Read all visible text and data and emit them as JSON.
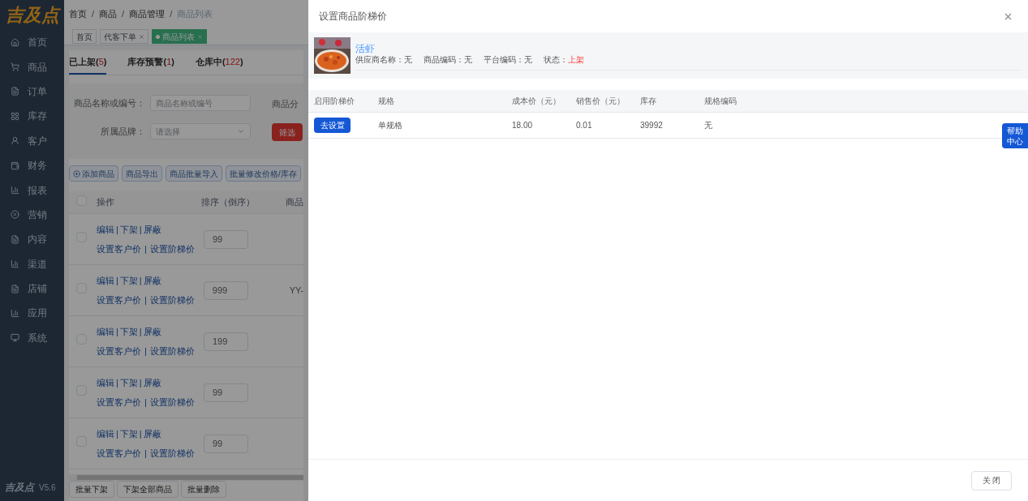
{
  "sidebar": {
    "logo": "吉及点",
    "items": [
      {
        "label": "首页"
      },
      {
        "label": "商品"
      },
      {
        "label": "订单"
      },
      {
        "label": "库存"
      },
      {
        "label": "客户"
      },
      {
        "label": "财务"
      },
      {
        "label": "报表"
      },
      {
        "label": "营销"
      },
      {
        "label": "内容"
      },
      {
        "label": "渠道"
      },
      {
        "label": "店铺"
      },
      {
        "label": "应用"
      },
      {
        "label": "系统"
      }
    ],
    "footer_logo": "吉及点",
    "version": "V5.6"
  },
  "breadcrumb": [
    "首页",
    "商品",
    "商品管理",
    "商品列表"
  ],
  "breadcrumb_separator": "/",
  "link_separator": "|",
  "count_brackets": [
    "(",
    ")"
  ],
  "open_tabs": [
    {
      "label": "首页",
      "closable": false,
      "selected": false
    },
    {
      "label": "代客下单",
      "closable": true,
      "selected": false
    },
    {
      "label": "商品列表",
      "closable": true,
      "selected": true
    }
  ],
  "status_tabs": [
    {
      "label": "已上架",
      "count": "5",
      "selected": true
    },
    {
      "label": "库存预警",
      "count": "1",
      "selected": false
    },
    {
      "label": "仓库中",
      "count": "122",
      "selected": false
    }
  ],
  "filters": [
    {
      "kind": "text",
      "label": "商品名称或编号：",
      "placeholder": "商品名称或编号"
    },
    {
      "kind": "select",
      "label": "所属品牌：",
      "placeholder": "请选择"
    }
  ],
  "filter_cut_label": "商品分",
  "filter_button": "筛选",
  "actions": [
    {
      "label": "添加商品",
      "kind": "add"
    },
    {
      "label": "商品导出",
      "kind": "plain"
    },
    {
      "label": "商品批量导入",
      "kind": "plain"
    },
    {
      "label": "批量修改价格/库存",
      "kind": "plain"
    }
  ],
  "product_table": {
    "header_checked": false,
    "columns": [
      "操作",
      "排序（倒序）",
      "商品"
    ],
    "rows": [
      {
        "checked": false,
        "actions": [
          "编辑",
          "下架",
          "屏蔽"
        ],
        "price_links": [
          "设置客户价",
          "设置阶梯价"
        ],
        "sort": "99"
      },
      {
        "checked": false,
        "actions": [
          "编辑",
          "下架",
          "屏蔽"
        ],
        "price_links": [
          "设置客户价",
          "设置阶梯价"
        ],
        "sort": "999",
        "column_3": "YY-"
      },
      {
        "checked": false,
        "actions": [
          "编辑",
          "下架",
          "屏蔽"
        ],
        "price_links": [
          "设置客户价",
          "设置阶梯价"
        ],
        "sort": "199"
      },
      {
        "checked": false,
        "actions": [
          "编辑",
          "下架",
          "屏蔽"
        ],
        "price_links": [
          "设置客户价",
          "设置阶梯价"
        ],
        "sort": "99"
      },
      {
        "checked": false,
        "actions": [
          "编辑",
          "下架",
          "屏蔽"
        ],
        "price_links": [
          "设置客户价",
          "设置阶梯价"
        ],
        "sort": "99"
      }
    ]
  },
  "bulk_buttons": [
    "批量下架",
    "下架全部商品",
    "批量删除"
  ],
  "drawer": {
    "title": "设置商品阶梯价",
    "product": {
      "name": "活虾",
      "fields": [
        {
          "label": "供应商名称：",
          "value": "无"
        },
        {
          "label": "商品编码：",
          "value": "无"
        },
        {
          "label": "平台编码：",
          "value": "无"
        },
        {
          "label": "状态：",
          "value": "上架",
          "kind": "status"
        }
      ]
    },
    "table": {
      "columns": [
        "启用阶梯价",
        "规格",
        "成本价（元）",
        "销售价（元）",
        "库存",
        "规格编码"
      ],
      "rows": [
        {
          "button": "去设置",
          "spec": "单规格",
          "cost": "18.00",
          "price": "0.01",
          "stock": "39992",
          "code": "无"
        }
      ]
    },
    "close_button": "关 闭"
  },
  "help_button": "帮助中心"
}
